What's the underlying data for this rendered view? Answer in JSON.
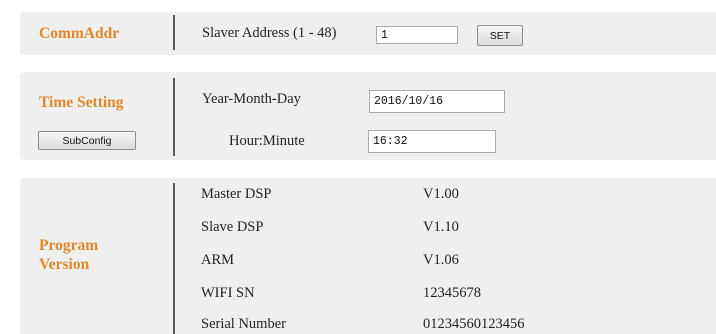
{
  "comm_addr": {
    "title": "CommAddr",
    "slave_address_label": "Slaver Address  (1 - 48)",
    "slave_address_value": "1",
    "set_button": "SET"
  },
  "time_setting": {
    "title": "Time Setting",
    "subconfig_button": "SubConfig",
    "date_label": "Year-Month-Day",
    "date_value": "2016/10/16",
    "time_label": "Hour:Minute",
    "time_value": "16:32"
  },
  "program_version": {
    "title_line1": "Program",
    "title_line2": "Version",
    "rows": [
      {
        "label": "Master DSP",
        "value": "V1.00"
      },
      {
        "label": "Slave DSP",
        "value": "V1.10"
      },
      {
        "label": "ARM",
        "value": "V1.06"
      },
      {
        "label": "WIFI SN",
        "value": "12345678"
      },
      {
        "label": "Serial Number",
        "value": "01234560123456"
      }
    ]
  }
}
